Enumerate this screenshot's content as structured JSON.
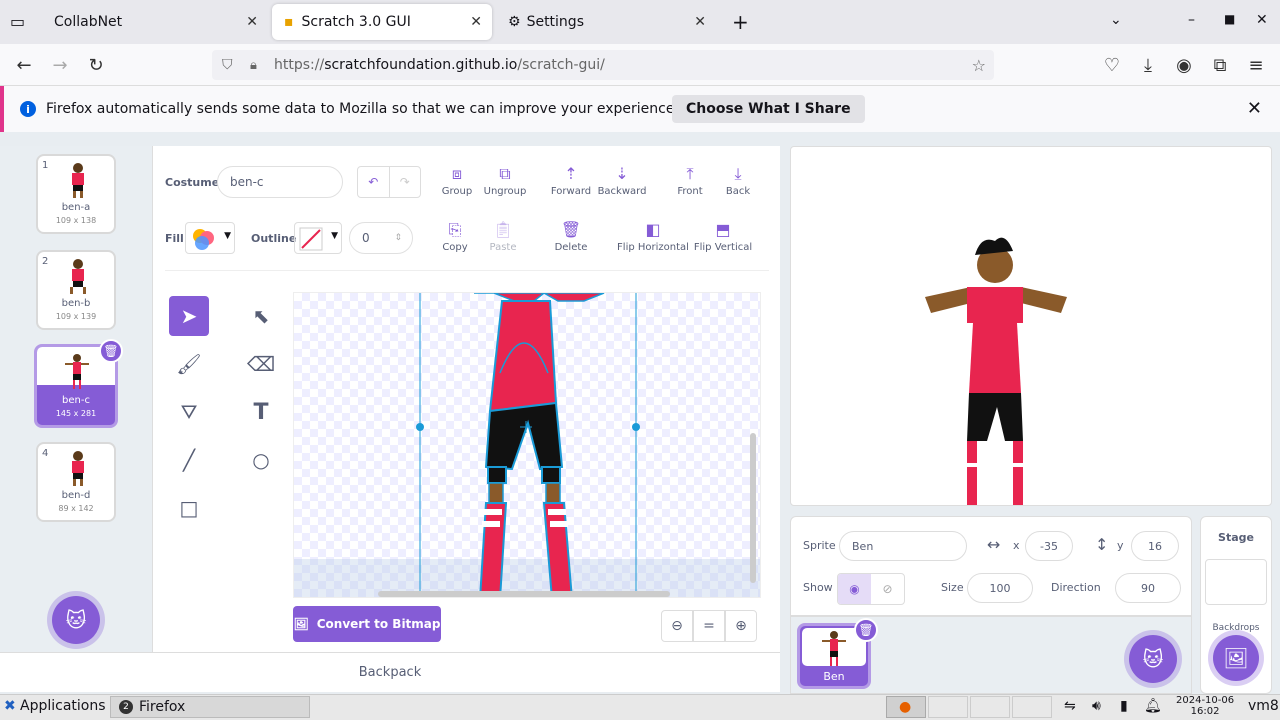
{
  "browser": {
    "tabs": [
      {
        "title": "CollabNet",
        "active": false
      },
      {
        "title": "Scratch 3.0 GUI",
        "active": true
      },
      {
        "title": "Settings",
        "active": false
      }
    ],
    "url_scheme": "https://",
    "url_host": "scratchfoundation.github.io",
    "url_path": "/scratch-gui/",
    "notification": {
      "text": "Firefox automatically sends some data to Mozilla so that we can improve your experience.",
      "button": "Choose What I Share"
    }
  },
  "costumes": [
    {
      "num": "1",
      "name": "ben-a",
      "size": "109 x 138"
    },
    {
      "num": "2",
      "name": "ben-b",
      "size": "109 x 139"
    },
    {
      "num": "3",
      "name": "ben-c",
      "size": "145 x 281"
    },
    {
      "num": "4",
      "name": "ben-d",
      "size": "89 x 142"
    }
  ],
  "editor": {
    "costume_label": "Costume",
    "costume_name": "ben-c",
    "fill_label": "Fill",
    "outline_label": "Outline",
    "outline_width": "0",
    "toolbar": {
      "group": "Group",
      "ungroup": "Ungroup",
      "forward": "Forward",
      "backward": "Backward",
      "front": "Front",
      "back": "Back",
      "copy": "Copy",
      "paste": "Paste",
      "delete": "Delete",
      "flip_h": "Flip Horizontal",
      "flip_v": "Flip Vertical"
    },
    "convert_button": "Convert to Bitmap"
  },
  "backpack": "Backpack",
  "sprite": {
    "sprite_label": "Sprite",
    "name": "Ben",
    "x_label": "x",
    "x": "-35",
    "y_label": "y",
    "y": "16",
    "show_label": "Show",
    "size_label": "Size",
    "size": "100",
    "direction_label": "Direction",
    "direction": "90",
    "list_item": "Ben"
  },
  "stage_panel": {
    "title": "Stage",
    "backdrops": "Backdrops"
  },
  "taskbar": {
    "apps": "Applications",
    "firefox": "Firefox",
    "badge": "2",
    "date": "2024-10-06",
    "time": "16:02",
    "user": "vm8"
  },
  "colors": {
    "accent": "#855cd6",
    "notif_border": "#e0348b"
  }
}
